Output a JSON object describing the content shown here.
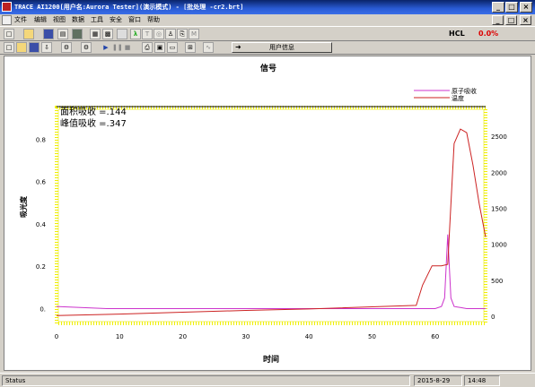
{
  "titlebar": {
    "title": "TRACE AI1200[用户名:Aurora Tester](演示模式) - [批处理 -cr2.brt]"
  },
  "menu": [
    "文件",
    "编辑",
    "视图",
    "数据",
    "工具",
    "安全",
    "窗口",
    "帮助"
  ],
  "toolbar": {
    "hcl_label": "HCL",
    "hcl_value": "0.0%",
    "user_info_label": "用户信息"
  },
  "chart": {
    "title": "信号",
    "annotations": [
      "面积吸收 =.144",
      "峰值吸收 =.347"
    ],
    "xlabel": "时间",
    "ylabel": "吸光度",
    "legend": [
      "原子吸收",
      "温度"
    ]
  },
  "chart_data": {
    "type": "line",
    "title": "信号",
    "xlabel": "时间",
    "ylabel": "吸光度",
    "xlim": [
      0,
      68
    ],
    "xticks": [
      0,
      10,
      20,
      30,
      40,
      50,
      60
    ],
    "ylim_left": [
      -0.07,
      0.95
    ],
    "yticks_left": [
      "0.8",
      "0.6",
      "0.4",
      "0.2",
      "0."
    ],
    "yticks_left_values": [
      0.8,
      0.6,
      0.4,
      0.2,
      0
    ],
    "ylim_right": [
      -100,
      2900
    ],
    "yticks_right": [
      2500,
      2000,
      1500,
      1000,
      500,
      0
    ],
    "legend_position": "top-right",
    "grid": false,
    "series": [
      {
        "name": "原子吸收",
        "color": "#cc33cc",
        "axis": "left",
        "x": [
          0,
          8,
          20,
          35,
          50,
          58,
          60,
          61,
          61.5,
          62,
          62.5,
          63,
          64,
          65,
          66,
          67,
          68
        ],
        "y": [
          0.01,
          0.0,
          0.0,
          0.0,
          0.0,
          0.0,
          0.0,
          0.01,
          0.05,
          0.35,
          0.05,
          0.01,
          0.005,
          0.0,
          0.0,
          0.0,
          0.0
        ]
      },
      {
        "name": "温度",
        "color": "#cc2222",
        "axis": "right",
        "x": [
          0,
          10,
          20,
          30,
          40,
          50,
          57,
          58,
          59.5,
          61,
          62,
          62.5,
          63,
          64,
          65,
          66,
          67,
          68
        ],
        "y": [
          10,
          30,
          55,
          80,
          100,
          130,
          150,
          430,
          700,
          700,
          720,
          1550,
          2400,
          2600,
          2550,
          2100,
          1550,
          1100
        ]
      }
    ]
  },
  "statusbar": {
    "status": "Status",
    "date": "2015-8-29",
    "time": "14:48"
  }
}
